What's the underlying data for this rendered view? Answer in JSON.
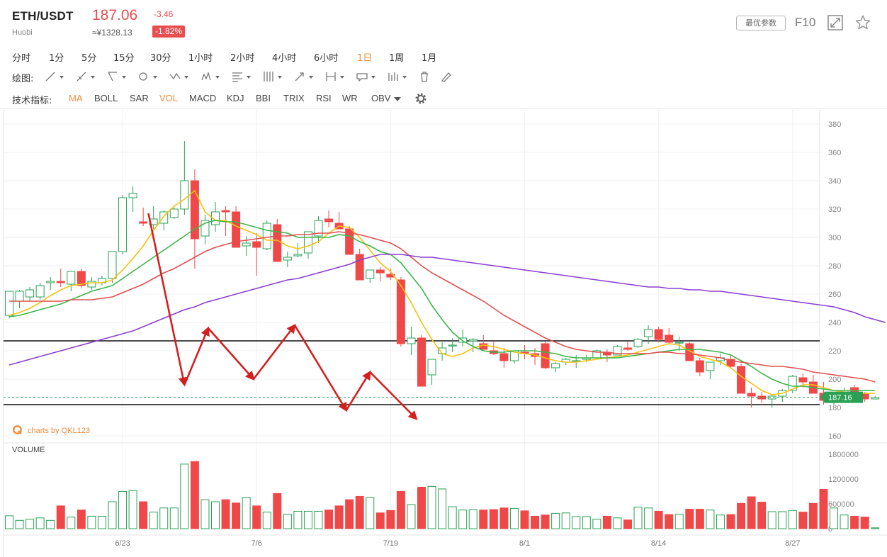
{
  "header": {
    "pair": "ETH/USDT",
    "exchange": "Huobi",
    "price": "187.06",
    "price_cny": "≈¥1328.13",
    "change": "-3.46",
    "change_pct": "-1.82%",
    "params_label": "最优参数",
    "f10_label": "F10"
  },
  "periods": [
    {
      "label": "分时",
      "active": false
    },
    {
      "label": "1分",
      "active": false
    },
    {
      "label": "5分",
      "active": false
    },
    {
      "label": "15分",
      "active": false
    },
    {
      "label": "30分",
      "active": false
    },
    {
      "label": "1小时",
      "active": false
    },
    {
      "label": "2小时",
      "active": false
    },
    {
      "label": "4小时",
      "active": false
    },
    {
      "label": "6小时",
      "active": false
    },
    {
      "label": "1日",
      "active": true
    },
    {
      "label": "1周",
      "active": false
    },
    {
      "label": "1月",
      "active": false
    }
  ],
  "drawing": {
    "label": "绘图:",
    "tools": [
      "line-tool-icon",
      "ray-tool-icon",
      "channel-tool-icon",
      "shape-tool-icon",
      "zigzag-tool-icon",
      "pattern-tool-icon",
      "fibonacci-tool-icon",
      "gann-tool-icon",
      "arrow-tool-icon",
      "measure-tool-icon",
      "annotation-tool-icon",
      "bars-tool-icon",
      "trash-icon",
      "eraser-icon"
    ]
  },
  "indicators": {
    "label": "技术指标:",
    "items": [
      {
        "label": "MA",
        "active": true
      },
      {
        "label": "BOLL",
        "active": false
      },
      {
        "label": "SAR",
        "active": false
      },
      {
        "label": "VOL",
        "active": true
      },
      {
        "label": "MACD",
        "active": false
      },
      {
        "label": "KDJ",
        "active": false
      },
      {
        "label": "BBI",
        "active": false
      },
      {
        "label": "TRIX",
        "active": false
      },
      {
        "label": "RSI",
        "active": false
      },
      {
        "label": "WR",
        "active": false
      },
      {
        "label": "OBV",
        "active": false
      }
    ]
  },
  "brand": "charts by QKL123",
  "volume_title": "VOLUME",
  "colors": {
    "up": "#2aa055",
    "down": "#f04848",
    "accent": "#f08c3a",
    "ma5": "#f5c211",
    "ma10": "#3cb54a",
    "ma20": "#e05050",
    "ma60": "#8a3fd0",
    "annotation": "#d41f1f"
  },
  "chart_data": {
    "type": "candlestick",
    "title": "",
    "xlabel": "",
    "ylabel": "",
    "ylim": [
      150,
      385
    ],
    "yticks": [
      380,
      360,
      340,
      320,
      300,
      280,
      260,
      240,
      220,
      200,
      180,
      160
    ],
    "xticks": [
      "6/23",
      "7/6",
      "7/19",
      "8/1",
      "8/14",
      "8/27"
    ],
    "current_price_tag": "187.16",
    "candles": [
      [
        245,
        262,
        243,
        262,
        310000
      ],
      [
        255,
        263,
        250,
        262,
        200000
      ],
      [
        258,
        265,
        255,
        263,
        230000
      ],
      [
        258,
        268,
        256,
        266,
        260000
      ],
      [
        268,
        272,
        263,
        269,
        200000
      ],
      [
        269,
        278,
        265,
        268,
        550000
      ],
      [
        267,
        275,
        262,
        276,
        280000
      ],
      [
        276,
        278,
        264,
        266,
        450000
      ],
      [
        265,
        272,
        263,
        269,
        300000
      ],
      [
        268,
        273,
        266,
        271,
        300000
      ],
      [
        271,
        290,
        268,
        290,
        650000
      ],
      [
        290,
        330,
        288,
        328,
        900000
      ],
      [
        328,
        336,
        318,
        331,
        920000
      ],
      [
        311,
        321,
        308,
        310,
        650000
      ],
      [
        309,
        322,
        306,
        313,
        400000
      ],
      [
        310,
        319,
        305,
        318,
        500000
      ],
      [
        314,
        321,
        313,
        320,
        500000
      ],
      [
        320,
        368,
        316,
        340,
        1560000
      ],
      [
        340,
        348,
        278,
        299,
        1620000
      ],
      [
        301,
        316,
        295,
        312,
        700000
      ],
      [
        309,
        325,
        304,
        318,
        650000
      ],
      [
        319,
        322,
        301,
        318,
        700000
      ],
      [
        318,
        322,
        294,
        293,
        620000
      ],
      [
        294,
        301,
        287,
        296,
        750000
      ],
      [
        297,
        303,
        273,
        293,
        550000
      ],
      [
        292,
        312,
        291,
        310,
        400000
      ],
      [
        309,
        313,
        295,
        283,
        850000
      ],
      [
        284,
        290,
        279,
        286,
        350000
      ],
      [
        287,
        296,
        286,
        288,
        420000
      ],
      [
        289,
        300,
        285,
        304,
        420000
      ],
      [
        301,
        315,
        296,
        312,
        420000
      ],
      [
        313,
        319,
        307,
        311,
        450000
      ],
      [
        310,
        318,
        306,
        306,
        550000
      ],
      [
        306,
        308,
        288,
        288,
        700000
      ],
      [
        288,
        292,
        270,
        270,
        780000
      ],
      [
        271,
        276,
        268,
        277,
        750000
      ],
      [
        277,
        279,
        269,
        275,
        380000
      ],
      [
        274,
        278,
        270,
        272,
        440000
      ],
      [
        270,
        272,
        223,
        225,
        900000
      ],
      [
        225,
        237,
        217,
        229,
        580000
      ],
      [
        229,
        231,
        196,
        195,
        1000000
      ],
      [
        203,
        214,
        196,
        214,
        1020000
      ],
      [
        218,
        226,
        213,
        222,
        960000
      ],
      [
        224,
        229,
        219,
        224,
        530000
      ],
      [
        226,
        235,
        223,
        229,
        450000
      ],
      [
        227,
        229,
        219,
        228,
        460000
      ],
      [
        225,
        231,
        221,
        221,
        450000
      ],
      [
        220,
        227,
        217,
        218,
        460000
      ],
      [
        218,
        222,
        208,
        213,
        500000
      ],
      [
        213,
        220,
        211,
        220,
        490000
      ],
      [
        219,
        224,
        214,
        218,
        430000
      ],
      [
        218,
        222,
        210,
        216,
        300000
      ],
      [
        225,
        227,
        207,
        208,
        330000
      ],
      [
        208,
        212,
        205,
        211,
        370000
      ],
      [
        212,
        215,
        210,
        214,
        380000
      ],
      [
        213,
        217,
        208,
        213,
        290000
      ],
      [
        214,
        217,
        212,
        215,
        290000
      ],
      [
        215,
        221,
        214,
        220,
        230000
      ],
      [
        219,
        221,
        212,
        217,
        300000
      ],
      [
        217,
        224,
        217,
        223,
        260000
      ],
      [
        222,
        227,
        220,
        221,
        210000
      ],
      [
        223,
        229,
        222,
        228,
        520000
      ],
      [
        230,
        238,
        225,
        235,
        500000
      ],
      [
        235,
        237,
        226,
        228,
        420000
      ],
      [
        231,
        236,
        225,
        226,
        340000
      ],
      [
        226,
        230,
        220,
        226,
        350000
      ],
      [
        225,
        226,
        213,
        213,
        470000
      ],
      [
        213,
        215,
        202,
        205,
        470000
      ],
      [
        206,
        211,
        200,
        212,
        450000
      ],
      [
        213,
        218,
        210,
        215,
        330000
      ],
      [
        214,
        217,
        208,
        209,
        340000
      ],
      [
        209,
        211,
        190,
        190,
        610000
      ],
      [
        190,
        194,
        180,
        188,
        770000
      ],
      [
        188,
        191,
        183,
        186,
        640000
      ],
      [
        186,
        189,
        180,
        188,
        410000
      ],
      [
        188,
        193,
        184,
        192,
        410000
      ],
      [
        192,
        203,
        190,
        202,
        440000
      ],
      [
        201,
        204,
        194,
        198,
        400000
      ],
      [
        198,
        203,
        194,
        190,
        610000
      ],
      [
        190,
        198,
        182,
        185,
        950000
      ],
      [
        186,
        190,
        182,
        188,
        500000
      ],
      [
        189,
        194,
        186,
        192,
        330000
      ],
      [
        194,
        196,
        184,
        187,
        300000
      ],
      [
        190,
        191,
        184,
        186,
        280000
      ],
      [
        186,
        188,
        186,
        187,
        20000
      ]
    ],
    "series": [
      {
        "name": "MA5",
        "values": [
          245,
          247,
          250,
          254,
          259,
          263,
          266,
          267,
          268,
          268,
          270,
          277,
          285,
          294,
          305,
          315,
          322,
          327,
          333,
          318,
          312,
          312,
          308,
          305,
          302,
          298,
          298,
          294,
          292,
          294,
          297,
          303,
          308,
          307,
          300,
          291,
          282,
          276,
          266,
          254,
          240,
          228,
          218,
          216,
          218,
          222,
          224,
          223,
          221,
          219,
          218,
          217,
          215,
          213,
          212,
          212,
          213,
          214,
          215,
          216,
          217,
          219,
          221,
          223,
          225,
          224,
          220,
          216,
          214,
          212,
          208,
          202,
          197,
          192,
          189,
          190,
          193,
          196,
          196,
          194,
          192,
          191,
          190,
          190,
          190
        ]
      },
      {
        "name": "MA10",
        "values": [
          244,
          245,
          247,
          249,
          251,
          253,
          256,
          259,
          262,
          264,
          266,
          271,
          276,
          281,
          286,
          291,
          296,
          301,
          306,
          310,
          312,
          311,
          311,
          309,
          307,
          305,
          304,
          303,
          300,
          300,
          300,
          300,
          302,
          301,
          297,
          294,
          290,
          288,
          282,
          273,
          264,
          252,
          242,
          233,
          227,
          223,
          220,
          219,
          219,
          220,
          220,
          220,
          219,
          218,
          216,
          215,
          215,
          215,
          215,
          215,
          216,
          217,
          218,
          219,
          220,
          221,
          221,
          221,
          220,
          219,
          217,
          213,
          209,
          204,
          200,
          197,
          195,
          195,
          194,
          193,
          192,
          192,
          192,
          192,
          192
        ]
      },
      {
        "name": "MA20",
        "values": [
          255,
          255,
          255,
          255,
          255,
          255,
          256,
          256,
          256,
          257,
          258,
          261,
          264,
          267,
          271,
          275,
          278,
          282,
          286,
          290,
          293,
          295,
          297,
          298,
          299,
          300,
          301,
          301,
          302,
          302,
          303,
          303,
          304,
          303,
          302,
          300,
          298,
          296,
          292,
          286,
          280,
          275,
          271,
          267,
          263,
          259,
          255,
          250,
          245,
          241,
          237,
          233,
          229,
          226,
          223,
          221,
          220,
          219,
          219,
          218,
          218,
          218,
          218,
          219,
          219,
          218,
          218,
          217,
          216,
          215,
          213,
          212,
          211,
          210,
          209,
          209,
          208,
          207,
          205,
          204,
          203,
          202,
          201,
          200,
          198
        ]
      },
      {
        "name": "MA60",
        "values": [
          210,
          212,
          214,
          216,
          218,
          220,
          222,
          224,
          226,
          228,
          230,
          232,
          234,
          237,
          240,
          243,
          246,
          249,
          251,
          254,
          256,
          258,
          260,
          262,
          264,
          266,
          268,
          270,
          271,
          273,
          275,
          277,
          279,
          281,
          284,
          286,
          288,
          288,
          288,
          287,
          286,
          286,
          285,
          284,
          283,
          282,
          281,
          280,
          279,
          278,
          277,
          276,
          275,
          274,
          273,
          272,
          271,
          270,
          269,
          268,
          267,
          266,
          265,
          265,
          264,
          264,
          263,
          263,
          262,
          262,
          261,
          260,
          259,
          258,
          257,
          256,
          255,
          254,
          253,
          252,
          251,
          249,
          247,
          244,
          242,
          240
        ]
      }
    ],
    "levels": [
      227,
      182
    ],
    "annotation_path": [
      [
        13.5,
        317
      ],
      [
        17,
        196
      ],
      [
        19.3,
        236
      ],
      [
        23.7,
        200
      ],
      [
        27.7,
        238
      ],
      [
        32.7,
        178
      ],
      [
        35,
        205
      ],
      [
        39.5,
        172
      ]
    ],
    "volume_ylim": [
      0,
      1900000
    ],
    "volume_ticks": [
      "1800000",
      "1200000",
      "600000",
      "0"
    ],
    "volume_tick_values": [
      1800000,
      1200000,
      600000,
      0
    ]
  }
}
